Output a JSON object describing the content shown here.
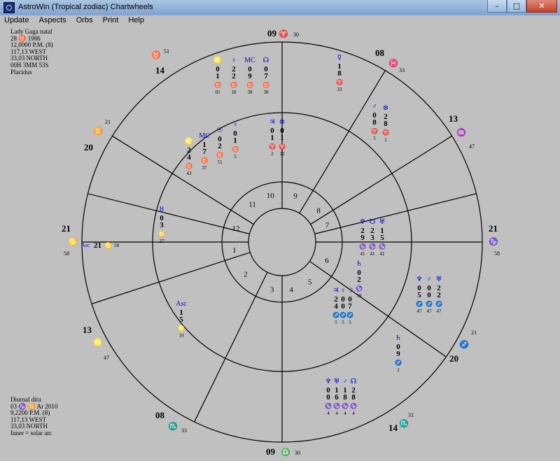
{
  "window": {
    "title": "AstroWin (Tropical zodiac)   Chartwheels"
  },
  "controls": {
    "minimize": "–",
    "maximize": "□",
    "close": "✕"
  },
  "menu": [
    "Update",
    "Aspects",
    "Orbs",
    "Print",
    "Help"
  ],
  "natal_info": [
    "Lady Gaga   natal",
    "28  ♉  1986",
    "12,0000 P.M. (8)",
    "117,13 WEST",
    "33,03 NORTH",
    "00H  3MM  53S",
    "Placidus"
  ],
  "progressed_info": [
    "Diurnal dira",
    "03  ♑  ♊ Ar 2010",
    "9,2200 P.M. (8)",
    "117,13 WEST",
    "33,03 NORTH",
    "Inner = solar arc"
  ],
  "chart": {
    "colors": {
      "lines": "#000000",
      "sign": "#cc0000",
      "planet": "#0000cc",
      "degree": "#000000",
      "minute": "#000000"
    },
    "cusp_labels": [
      {
        "deg": "21",
        "glyph": "♋",
        "min": "58",
        "side": "left"
      },
      {
        "deg": "21",
        "glyph": "♑",
        "min": "58",
        "side": "right"
      },
      {
        "deg": "09",
        "glyph": "♈",
        "min": "30",
        "side": "top"
      },
      {
        "deg": "09",
        "glyph": "♎",
        "min": "30",
        "side": "bottom"
      },
      {
        "deg": "14",
        "glyph": "♉",
        "min": "51",
        "side": "ul"
      },
      {
        "deg": "20",
        "glyph": "♊",
        "min": "21",
        "side": "ll1"
      },
      {
        "deg": "13",
        "glyph": "♌",
        "min": "47",
        "side": "ll2"
      },
      {
        "deg": "08",
        "glyph": "♏",
        "min": "33",
        "side": "lo"
      },
      {
        "deg": "08",
        "glyph": "♓",
        "min": "33",
        "side": "ur"
      },
      {
        "deg": "13",
        "glyph": "♒",
        "min": "47",
        "side": "ur2"
      },
      {
        "deg": "20",
        "glyph": "♐",
        "min": "21",
        "side": "lr"
      },
      {
        "deg": "14",
        "glyph": "♏",
        "min": "31",
        "side": "lr2"
      }
    ],
    "houses": [
      "1",
      "2",
      "3",
      "4",
      "5",
      "6",
      "7",
      "8",
      "9",
      "10",
      "11",
      "12"
    ],
    "outer_groups": [
      {
        "glyphs": [
          "♌",
          "♀",
          "MC",
          "☊"
        ],
        "cols": [
          [
            "0",
            "1"
          ],
          [
            "2",
            "2"
          ],
          [
            "0",
            "9"
          ],
          [
            "0",
            "7"
          ]
        ],
        "signs": [
          "♉",
          "♉",
          "♉",
          "♉"
        ],
        "mins": [
          "05",
          "18",
          "38",
          "38"
        ]
      },
      {
        "glyphs": [
          "☿"
        ],
        "cols": [
          [
            "1",
            "8"
          ]
        ],
        "signs": [
          "♈"
        ],
        "mins": [
          "33"
        ]
      },
      {
        "glyphs": [
          "♂",
          "⊗"
        ],
        "cols": [
          [
            "0",
            "8"
          ],
          [
            "2",
            "8"
          ]
        ],
        "signs": [
          "♈",
          "♈"
        ],
        "mins": [
          "5",
          "2"
        ]
      },
      {
        "glyphs": [
          "♆",
          "☋",
          "♅"
        ],
        "cols": [
          [
            "2",
            "9"
          ],
          [
            "2",
            "3"
          ],
          [
            "1",
            "5"
          ]
        ],
        "signs": [
          "♑",
          "♑",
          "♑"
        ],
        "mins": [
          "41",
          "41",
          "41"
        ]
      },
      {
        "glyphs": [
          "♄"
        ],
        "cols": [
          [
            "0",
            "2"
          ]
        ],
        "signs": [
          "♑"
        ],
        "mins": [
          "59"
        ]
      },
      {
        "glyphs": [
          "♆",
          "♂",
          "♅"
        ],
        "cols": [
          [
            "0",
            "5"
          ],
          [
            "0",
            "0"
          ],
          [
            "2",
            "2"
          ]
        ],
        "signs": [
          "♐",
          "♐",
          "♐"
        ],
        "mins": [
          "47",
          "47",
          "47"
        ]
      },
      {
        "glyphs": [
          "♄"
        ],
        "cols": [
          [
            "0",
            "9"
          ]
        ],
        "signs": [
          "♐"
        ],
        "mins": [
          "2"
        ]
      }
    ],
    "inner_groups": [
      {
        "glyphs": [
          "♌",
          "MC",
          "☉",
          "♀"
        ],
        "cols": [
          [
            "2",
            "4"
          ],
          [
            "1",
            "7"
          ],
          [
            "0",
            "2"
          ],
          [
            "0",
            "1"
          ]
        ],
        "signs": [
          "♉",
          "♉",
          "♉",
          "♉"
        ],
        "mins": [
          "43",
          "37",
          "51",
          "5"
        ]
      },
      {
        "glyphs": [
          "♃",
          "⊗"
        ],
        "cols": [
          [
            "0",
            "1"
          ],
          [
            "0",
            "1"
          ],
          [
            "1",
            "2"
          ],
          [
            "1",
            "2"
          ]
        ],
        "signs": [
          "♈",
          "♈",
          "♈",
          "♈"
        ],
        "mins": [
          "2",
          "12",
          "4",
          "4"
        ]
      },
      {
        "glyphs": [
          "Ȣ"
        ],
        "cols": [
          [
            "0",
            "3"
          ]
        ],
        "signs": [
          "♋"
        ],
        "mins": [
          "27"
        ]
      },
      {
        "glyphs": [
          "Asc"
        ],
        "cols": [
          [
            "1",
            "5"
          ]
        ],
        "signs": [
          "♌"
        ],
        "mins": [
          "19"
        ]
      }
    ],
    "asc_label": "Asc",
    "asc_value": "21",
    "asc_sign": "♋",
    "asc_min": "58"
  }
}
